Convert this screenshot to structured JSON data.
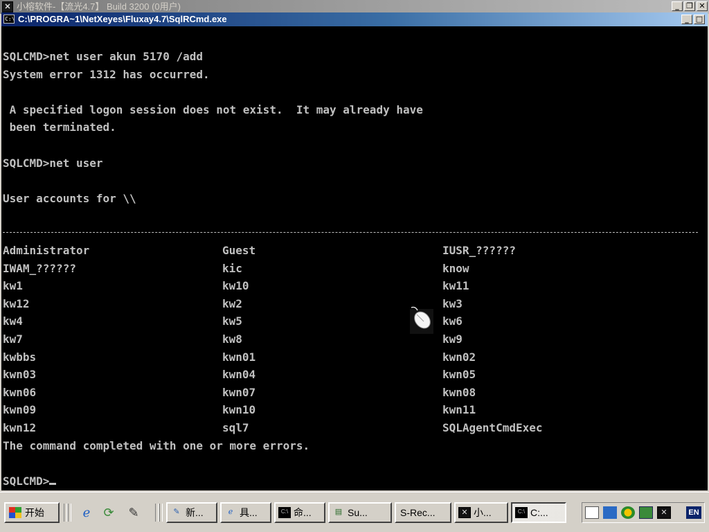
{
  "outer_window": {
    "title": "小榕软件-【流光4.7】 Build 3200 (0用户)",
    "icon": "app-x-icon"
  },
  "console_window": {
    "title": "C:\\PROGRA~1\\NetXeyes\\Fluxay4.7\\SqlRCmd.exe",
    "icon": "console-icon"
  },
  "console": {
    "lines": [
      "SQLCMD>net user akun 5170 /add",
      "System error 1312 has occurred.",
      "",
      " A specified logon session does not exist.  It may already have",
      " been terminated.",
      "",
      "SQLCMD>net user",
      "",
      "User accounts for \\\\"
    ],
    "accounts": [
      [
        "Administrator",
        "Guest",
        "IUSR_??????"
      ],
      [
        "IWAM_??????",
        "kic",
        "know"
      ],
      [
        "kw1",
        "kw10",
        "kw11"
      ],
      [
        "kw12",
        "kw2",
        "kw3"
      ],
      [
        "kw4",
        "kw5",
        "kw6"
      ],
      [
        "kw7",
        "kw8",
        "kw9"
      ],
      [
        "kwbbs",
        "kwn01",
        "kwn02"
      ],
      [
        "kwn03",
        "kwn04",
        "kwn05"
      ],
      [
        "kwn06",
        "kwn07",
        "kwn08"
      ],
      [
        "kwn09",
        "kwn10",
        "kwn11"
      ],
      [
        "kwn12",
        "sql7",
        "SQLAgentCmdExec"
      ]
    ],
    "completion": "The command completed with one or more errors.",
    "prompt": "SQLCMD>"
  },
  "taskbar": {
    "start_label": "开始",
    "quick_launch": [
      "ie-icon",
      "refresh-icon",
      "edit-icon"
    ],
    "tasks": [
      {
        "label": "新...",
        "icon": "notepad-icon"
      },
      {
        "label": "具...",
        "icon": "ie-icon"
      },
      {
        "label": "命...",
        "icon": "console-icon"
      },
      {
        "label": "Su...",
        "icon": "network-icon"
      },
      {
        "label": "S-Rec...",
        "icon": ""
      },
      {
        "label": "小...",
        "icon": "app-x-icon"
      },
      {
        "label": "C:...",
        "icon": "console-icon"
      }
    ],
    "tray_language": "EN"
  },
  "colors": {
    "console_bg": "#000000",
    "console_text": "#c0c0c0",
    "active_title": "#0a246a",
    "inactive_title": "#7b7b7b",
    "chrome": "#d4d0c8"
  }
}
